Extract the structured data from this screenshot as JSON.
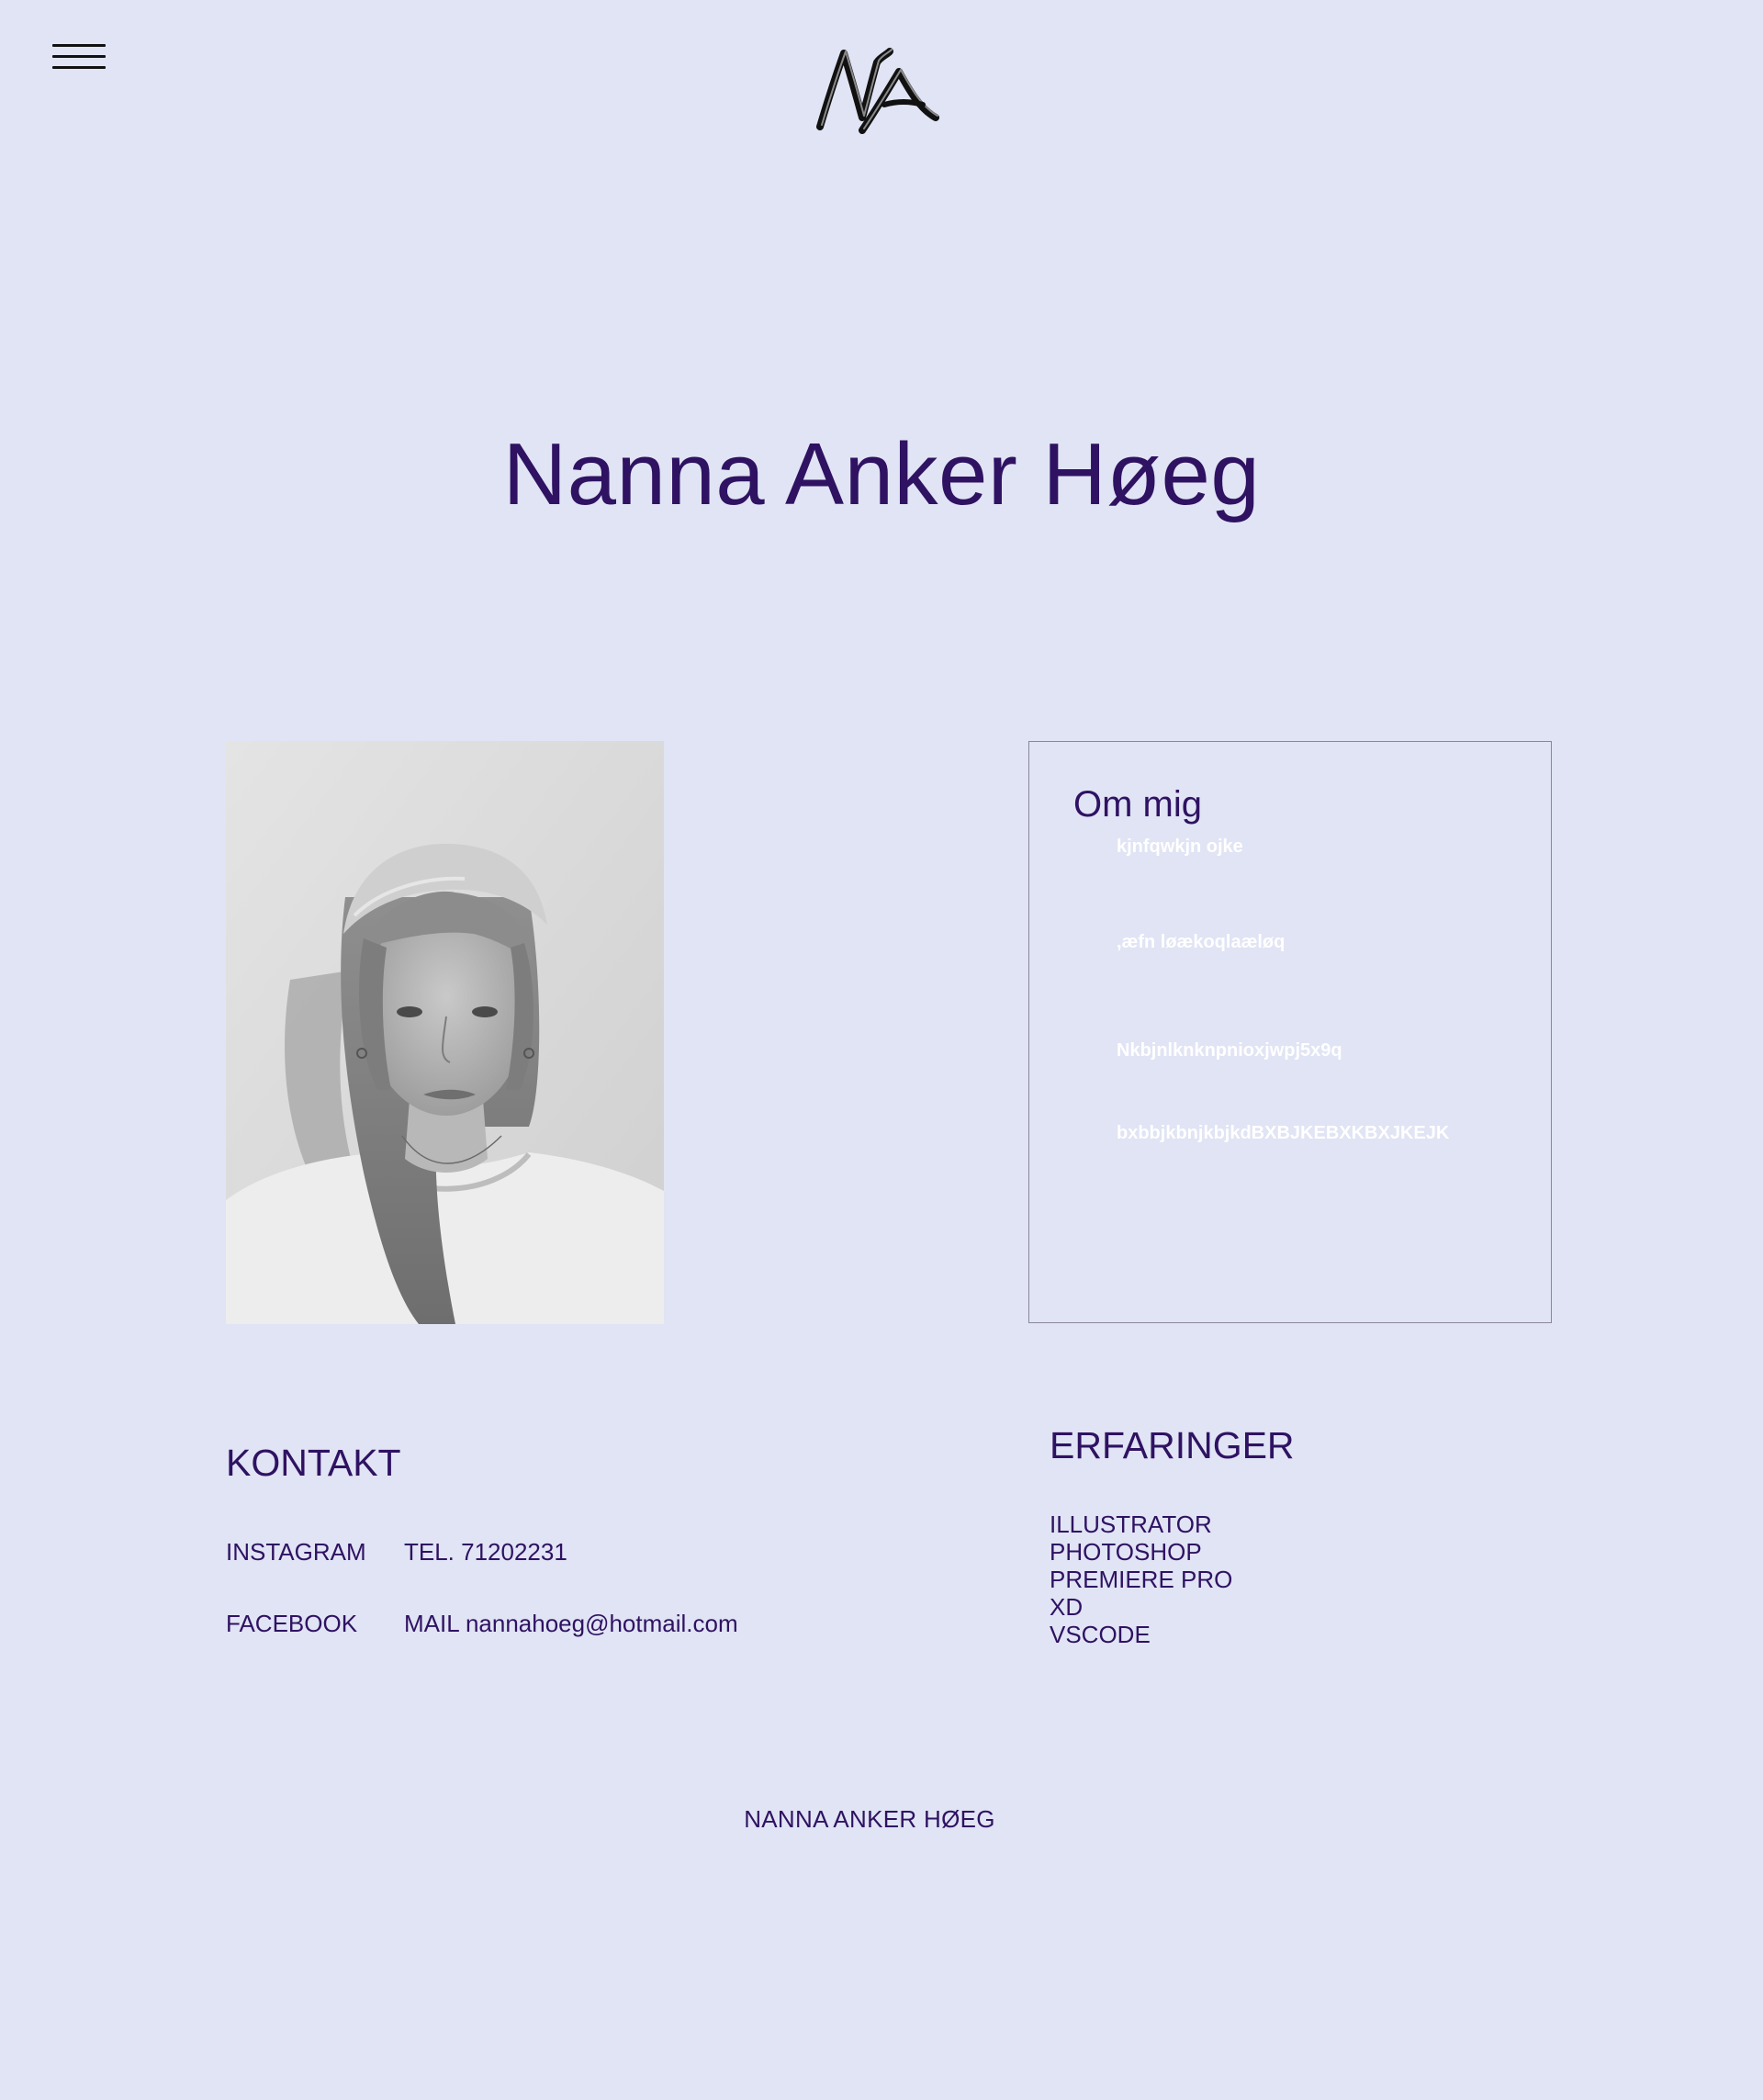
{
  "nav": {
    "menu_icon": "hamburger-menu-icon",
    "logo_icon": "na-monogram-logo"
  },
  "hero": {
    "title": "Nanna Anker Høeg"
  },
  "portrait": {
    "style": "black-and-white portrait photo"
  },
  "about": {
    "title": "Om mig",
    "lines": [
      "kjnfqwkjn  ojke",
      ",æfn løækoqlaæløq",
      "Nkbjnlknknpnioxjwpj5x9q",
      "bxbbjkbnjkbjkdBXBJKEBXKBXJKEJK"
    ]
  },
  "kontakt": {
    "title": "KONTAKT",
    "instagram": "INSTAGRAM",
    "tel": "TEL. 71202231",
    "facebook": "FACEBOOK",
    "mail": "MAIL nannahoeg@hotmail.com"
  },
  "erfaringer": {
    "title": "ERFARINGER",
    "items": [
      "ILLUSTRATOR",
      "PHOTOSHOP",
      "PREMIERE PRO",
      "XD",
      "VSCODE"
    ]
  },
  "footer": {
    "text": "NANNA ANKER HØEG"
  },
  "colors": {
    "background": "#e0e4f4",
    "text": "#2f1262",
    "about_text": "#ffffff",
    "box_border": "#8a8799"
  }
}
